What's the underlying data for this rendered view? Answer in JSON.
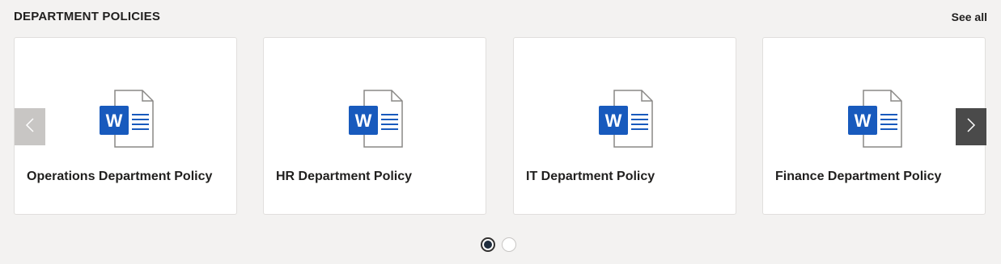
{
  "section": {
    "title": "DEPARTMENT POLICIES",
    "see_all": "See all"
  },
  "cards": [
    {
      "title": "Operations Department Policy",
      "icon": "word-document-icon",
      "icon_letter": "W"
    },
    {
      "title": "HR Department Policy",
      "icon": "word-document-icon",
      "icon_letter": "W"
    },
    {
      "title": "IT Department Policy",
      "icon": "word-document-icon",
      "icon_letter": "W"
    },
    {
      "title": "Finance Department Policy",
      "icon": "word-document-icon",
      "icon_letter": "W"
    }
  ],
  "carousel": {
    "page_count": 2,
    "active_page": 1,
    "prev_icon": "chevron-left-icon",
    "next_icon": "chevron-right-icon"
  },
  "colors": {
    "background": "#f3f2f1",
    "card": "#ffffff",
    "word_blue": "#185abd",
    "prev_arrow_bg": "#c8c6c4",
    "next_arrow_bg": "#4a4a4a"
  }
}
